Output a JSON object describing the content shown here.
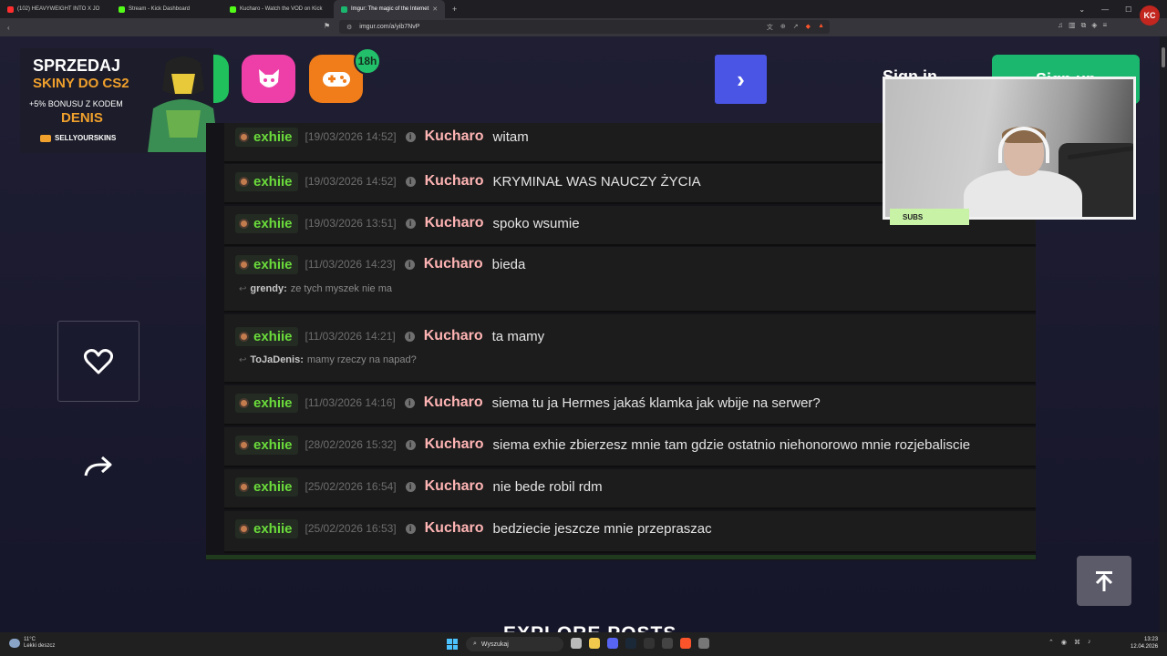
{
  "browser": {
    "tabs": [
      {
        "label": "(102) HEAVYWEIGHT INTO X JO",
        "color": "#ff2d2d",
        "active": false
      },
      {
        "label": "Stream - Kick Dashboard",
        "color": "#53fc18",
        "active": false
      },
      {
        "label": "Kucharo - Watch the VOD on Kick",
        "color": "#53fc18",
        "active": false
      },
      {
        "label": "Imgur: The magic of the Internet",
        "color": "#1bb76e",
        "active": true
      }
    ],
    "new_tab": "+",
    "url": "imgur.com/a/yib7NvP"
  },
  "header": {
    "badge": "18h",
    "signin": "Sign in",
    "signup": "Sign up"
  },
  "ad": {
    "line1": "SPRZEDAJ",
    "line2": "SKINY DO CS2",
    "bonus": "+5% BONUSU Z KODEM",
    "code": "DENIS",
    "brand": "SELLYOURSKINS"
  },
  "chat": [
    {
      "user": "exhiie",
      "time": "[19/03/2026 14:52]",
      "author": "Kucharo",
      "text": "witam"
    },
    {
      "user": "exhiie",
      "time": "[19/03/2026 14:52]",
      "author": "Kucharo",
      "text": "KRYMINAŁ WAS NAUCZY ŻYCIA"
    },
    {
      "user": "exhiie",
      "time": "[19/03/2026 13:51]",
      "author": "Kucharo",
      "text": "spoko wsumie"
    },
    {
      "user": "exhiie",
      "time": "[11/03/2026 14:23]",
      "author": "Kucharo",
      "text": "bieda",
      "reply_user": "grendy:",
      "reply_text": "ze tych myszek nie ma"
    },
    {
      "user": "exhiie",
      "time": "[11/03/2026 14:21]",
      "author": "Kucharo",
      "text": "ta mamy",
      "reply_user": "ToJaDenis:",
      "reply_text": "mamy rzeczy na napad?"
    },
    {
      "user": "exhiie",
      "time": "[11/03/2026 14:16]",
      "author": "Kucharo",
      "text": "siema tu ja Hermes jakaś klamka jak wbije na serwer?"
    },
    {
      "user": "exhiie",
      "time": "[28/02/2026 15:32]",
      "author": "Kucharo",
      "text": "siema exhie zbierzesz mnie tam gdzie ostatnio niehonorowo mnie rozjebaliscie"
    },
    {
      "user": "exhiie",
      "time": "[25/02/2026 16:54]",
      "author": "Kucharo",
      "text": "nie bede robil rdm"
    },
    {
      "user": "exhiie",
      "time": "[25/02/2026 16:53]",
      "author": "Kucharo",
      "text": "bedziecie jeszcze mnie przepraszac"
    }
  ],
  "info_glyph": "i",
  "explore": "EXPLORE POSTS",
  "overlay": {
    "subs": "SUBS",
    "kick_logo": "KC"
  },
  "taskbar": {
    "weather_temp": "11°C",
    "weather_desc": "Lekki deszcz",
    "search": "Wyszukaj",
    "time": "13:23",
    "date": "12.04.2026"
  }
}
